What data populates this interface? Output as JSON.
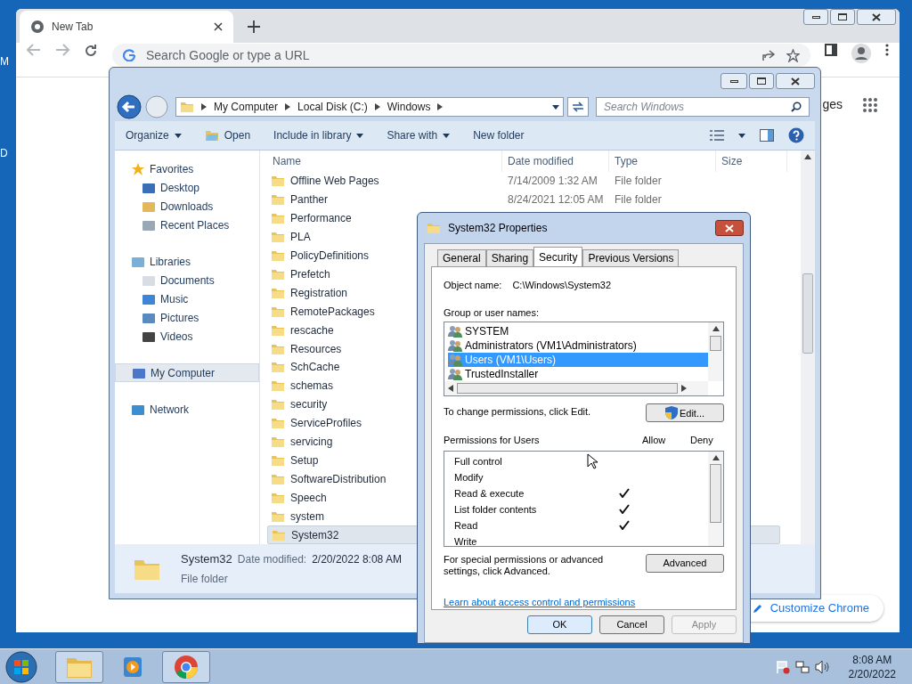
{
  "desktop": {
    "edge_labels": [
      "M",
      "D"
    ]
  },
  "browser": {
    "tabs": [
      {
        "title": "New Tab",
        "selected": true
      }
    ],
    "omnibox": {
      "placeholder": "Search Google or type a URL"
    },
    "partial_link": "ges",
    "customize_button": "Customize Chrome"
  },
  "explorer": {
    "breadcrumbs": [
      "My Computer",
      "Local Disk (C:)",
      "Windows"
    ],
    "search": {
      "placeholder": "Search Windows"
    },
    "commands": [
      {
        "label": "Organize",
        "dropdown": true
      },
      {
        "label": "Open",
        "dropdown": false
      },
      {
        "label": "Include in library",
        "dropdown": true
      },
      {
        "label": "Share with",
        "dropdown": true
      },
      {
        "label": "New folder",
        "dropdown": false
      }
    ],
    "nav": [
      {
        "label": "Favorites",
        "selected": false,
        "children": [
          {
            "label": "Desktop",
            "selected": false
          },
          {
            "label": "Downloads",
            "selected": false
          },
          {
            "label": "Recent Places",
            "selected": false
          }
        ]
      },
      {
        "label": "Libraries",
        "selected": false,
        "children": [
          {
            "label": "Documents",
            "selected": false
          },
          {
            "label": "Music",
            "selected": false
          },
          {
            "label": "Pictures",
            "selected": false
          },
          {
            "label": "Videos",
            "selected": false
          }
        ]
      },
      {
        "label": "My Computer",
        "selected": true
      },
      {
        "label": "Network",
        "selected": false
      }
    ],
    "columns": [
      "Name",
      "Date modified",
      "Type",
      "Size"
    ],
    "rows": [
      {
        "name": "Offline Web Pages",
        "date": "7/14/2009 1:32 AM",
        "type": "File folder",
        "selected": false
      },
      {
        "name": "Panther",
        "date": "8/24/2021 12:05 AM",
        "type": "File folder",
        "selected": false
      },
      {
        "name": "Performance",
        "selected": false
      },
      {
        "name": "PLA",
        "selected": false
      },
      {
        "name": "PolicyDefinitions",
        "selected": false
      },
      {
        "name": "Prefetch",
        "selected": false
      },
      {
        "name": "Registration",
        "selected": false
      },
      {
        "name": "RemotePackages",
        "selected": false
      },
      {
        "name": "rescache",
        "selected": false
      },
      {
        "name": "Resources",
        "selected": false
      },
      {
        "name": "SchCache",
        "selected": false
      },
      {
        "name": "schemas",
        "selected": false
      },
      {
        "name": "security",
        "selected": false
      },
      {
        "name": "ServiceProfiles",
        "selected": false
      },
      {
        "name": "servicing",
        "selected": false
      },
      {
        "name": "Setup",
        "selected": false
      },
      {
        "name": "SoftwareDistribution",
        "selected": false
      },
      {
        "name": "Speech",
        "selected": false
      },
      {
        "name": "system",
        "selected": false
      },
      {
        "name": "System32",
        "selected": true
      }
    ],
    "details": {
      "name": "System32",
      "date_label": "Date modified:",
      "date": "2/20/2022 8:08 AM",
      "type": "File folder"
    }
  },
  "dialog": {
    "title": "System32 Properties",
    "tabs": [
      {
        "label": "General",
        "selected": false
      },
      {
        "label": "Sharing",
        "selected": false
      },
      {
        "label": "Security",
        "selected": true
      },
      {
        "label": "Previous Versions",
        "selected": false
      }
    ],
    "object_label": "Object name:",
    "object_value": "C:\\Windows\\System32",
    "groups_label": "Group or user names:",
    "groups": [
      {
        "name": "SYSTEM",
        "selected": false
      },
      {
        "name": "Administrators (VM1\\Administrators)",
        "selected": false
      },
      {
        "name": "Users (VM1\\Users)",
        "selected": true
      },
      {
        "name": "TrustedInstaller",
        "selected": false
      }
    ],
    "change_note": "To change permissions, click Edit.",
    "edit_button": "Edit...",
    "permissions_label": "Permissions for Users",
    "allow_label": "Allow",
    "deny_label": "Deny",
    "permissions": [
      {
        "name": "Full control",
        "allow": false,
        "deny": false
      },
      {
        "name": "Modify",
        "allow": false,
        "deny": false
      },
      {
        "name": "Read & execute",
        "allow": true,
        "deny": false
      },
      {
        "name": "List folder contents",
        "allow": true,
        "deny": false
      },
      {
        "name": "Read",
        "allow": true,
        "deny": false
      },
      {
        "name": "Write",
        "allow": false,
        "deny": false
      }
    ],
    "advanced_note": "For special permissions or advanced settings, click Advanced.",
    "advanced_button": "Advanced",
    "link": "Learn about access control and permissions",
    "buttons": [
      {
        "label": "OK",
        "disabled": false
      },
      {
        "label": "Cancel",
        "disabled": false
      },
      {
        "label": "Apply",
        "disabled": true
      }
    ]
  },
  "taskbar": {
    "items": [
      {
        "open": true
      },
      {
        "open": false
      },
      {
        "open": true
      }
    ],
    "time": "8:08 AM",
    "date": "2/20/2022"
  }
}
